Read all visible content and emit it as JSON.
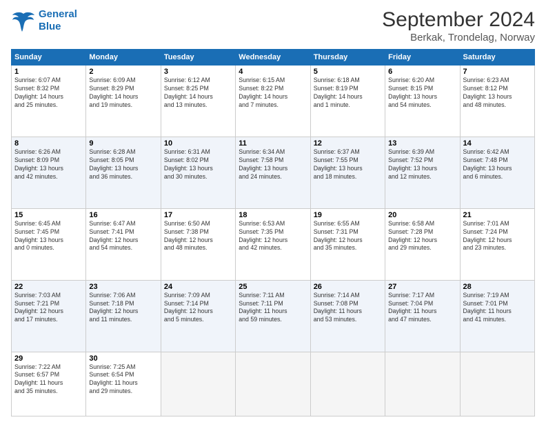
{
  "logo": {
    "line1": "General",
    "line2": "Blue"
  },
  "title": "September 2024",
  "subtitle": "Berkak, Trondelag, Norway",
  "headers": [
    "Sunday",
    "Monday",
    "Tuesday",
    "Wednesday",
    "Thursday",
    "Friday",
    "Saturday"
  ],
  "weeks": [
    [
      {
        "day": "1",
        "detail": "Sunrise: 6:07 AM\nSunset: 8:32 PM\nDaylight: 14 hours\nand 25 minutes."
      },
      {
        "day": "2",
        "detail": "Sunrise: 6:09 AM\nSunset: 8:29 PM\nDaylight: 14 hours\nand 19 minutes."
      },
      {
        "day": "3",
        "detail": "Sunrise: 6:12 AM\nSunset: 8:25 PM\nDaylight: 14 hours\nand 13 minutes."
      },
      {
        "day": "4",
        "detail": "Sunrise: 6:15 AM\nSunset: 8:22 PM\nDaylight: 14 hours\nand 7 minutes."
      },
      {
        "day": "5",
        "detail": "Sunrise: 6:18 AM\nSunset: 8:19 PM\nDaylight: 14 hours\nand 1 minute."
      },
      {
        "day": "6",
        "detail": "Sunrise: 6:20 AM\nSunset: 8:15 PM\nDaylight: 13 hours\nand 54 minutes."
      },
      {
        "day": "7",
        "detail": "Sunrise: 6:23 AM\nSunset: 8:12 PM\nDaylight: 13 hours\nand 48 minutes."
      }
    ],
    [
      {
        "day": "8",
        "detail": "Sunrise: 6:26 AM\nSunset: 8:09 PM\nDaylight: 13 hours\nand 42 minutes."
      },
      {
        "day": "9",
        "detail": "Sunrise: 6:28 AM\nSunset: 8:05 PM\nDaylight: 13 hours\nand 36 minutes."
      },
      {
        "day": "10",
        "detail": "Sunrise: 6:31 AM\nSunset: 8:02 PM\nDaylight: 13 hours\nand 30 minutes."
      },
      {
        "day": "11",
        "detail": "Sunrise: 6:34 AM\nSunset: 7:58 PM\nDaylight: 13 hours\nand 24 minutes."
      },
      {
        "day": "12",
        "detail": "Sunrise: 6:37 AM\nSunset: 7:55 PM\nDaylight: 13 hours\nand 18 minutes."
      },
      {
        "day": "13",
        "detail": "Sunrise: 6:39 AM\nSunset: 7:52 PM\nDaylight: 13 hours\nand 12 minutes."
      },
      {
        "day": "14",
        "detail": "Sunrise: 6:42 AM\nSunset: 7:48 PM\nDaylight: 13 hours\nand 6 minutes."
      }
    ],
    [
      {
        "day": "15",
        "detail": "Sunrise: 6:45 AM\nSunset: 7:45 PM\nDaylight: 13 hours\nand 0 minutes."
      },
      {
        "day": "16",
        "detail": "Sunrise: 6:47 AM\nSunset: 7:41 PM\nDaylight: 12 hours\nand 54 minutes."
      },
      {
        "day": "17",
        "detail": "Sunrise: 6:50 AM\nSunset: 7:38 PM\nDaylight: 12 hours\nand 48 minutes."
      },
      {
        "day": "18",
        "detail": "Sunrise: 6:53 AM\nSunset: 7:35 PM\nDaylight: 12 hours\nand 42 minutes."
      },
      {
        "day": "19",
        "detail": "Sunrise: 6:55 AM\nSunset: 7:31 PM\nDaylight: 12 hours\nand 35 minutes."
      },
      {
        "day": "20",
        "detail": "Sunrise: 6:58 AM\nSunset: 7:28 PM\nDaylight: 12 hours\nand 29 minutes."
      },
      {
        "day": "21",
        "detail": "Sunrise: 7:01 AM\nSunset: 7:24 PM\nDaylight: 12 hours\nand 23 minutes."
      }
    ],
    [
      {
        "day": "22",
        "detail": "Sunrise: 7:03 AM\nSunset: 7:21 PM\nDaylight: 12 hours\nand 17 minutes."
      },
      {
        "day": "23",
        "detail": "Sunrise: 7:06 AM\nSunset: 7:18 PM\nDaylight: 12 hours\nand 11 minutes."
      },
      {
        "day": "24",
        "detail": "Sunrise: 7:09 AM\nSunset: 7:14 PM\nDaylight: 12 hours\nand 5 minutes."
      },
      {
        "day": "25",
        "detail": "Sunrise: 7:11 AM\nSunset: 7:11 PM\nDaylight: 11 hours\nand 59 minutes."
      },
      {
        "day": "26",
        "detail": "Sunrise: 7:14 AM\nSunset: 7:08 PM\nDaylight: 11 hours\nand 53 minutes."
      },
      {
        "day": "27",
        "detail": "Sunrise: 7:17 AM\nSunset: 7:04 PM\nDaylight: 11 hours\nand 47 minutes."
      },
      {
        "day": "28",
        "detail": "Sunrise: 7:19 AM\nSunset: 7:01 PM\nDaylight: 11 hours\nand 41 minutes."
      }
    ],
    [
      {
        "day": "29",
        "detail": "Sunrise: 7:22 AM\nSunset: 6:57 PM\nDaylight: 11 hours\nand 35 minutes."
      },
      {
        "day": "30",
        "detail": "Sunrise: 7:25 AM\nSunset: 6:54 PM\nDaylight: 11 hours\nand 29 minutes."
      },
      {
        "day": "",
        "detail": ""
      },
      {
        "day": "",
        "detail": ""
      },
      {
        "day": "",
        "detail": ""
      },
      {
        "day": "",
        "detail": ""
      },
      {
        "day": "",
        "detail": ""
      }
    ]
  ]
}
